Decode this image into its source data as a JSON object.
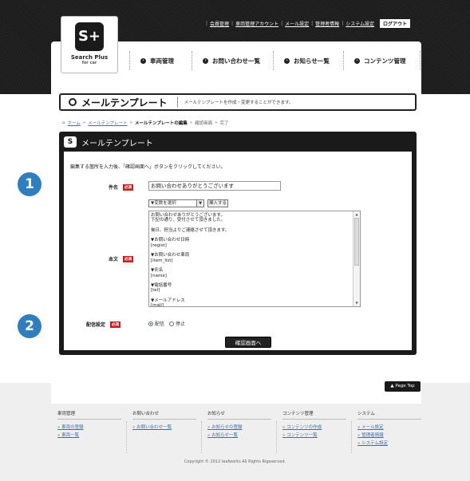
{
  "logo": {
    "mark": "S+",
    "title": "Search Plus",
    "sub": "for car"
  },
  "toplinks": [
    "会員管理",
    "車両管理アカウント",
    "メール設定",
    "管理者情報",
    "システム設定"
  ],
  "logout_label": "ログアウト",
  "nav": [
    "車両管理",
    "お問い合わせ一覧",
    "お知らせ一覧",
    "コンテンツ管理"
  ],
  "page": {
    "title": "メールテンプレート",
    "desc": "メールテンプレートを作成・変更することができます。"
  },
  "breadcrumb": {
    "home": "ホーム",
    "template": "メールテンプレート",
    "current": "メールテンプレートの編集",
    "confirm": "確認画面",
    "done": "完了",
    "sep": "»"
  },
  "panel": {
    "title": "メールテンプレート",
    "instruction": "編集する箇所を入力後、「確認画面へ」ボタンをクリックしてください。",
    "required_label": "必須",
    "subject_label": "件名",
    "subject_value": "お問い合わせありがとうございます",
    "var_select": "▼変数を選択",
    "insert_button": "挿入する",
    "body_label": "本文",
    "body_lines": [
      "お問い合わせありがとうございます。",
      "下記の通り、受付させて頂きました。",
      "",
      "後日、担当よりご連絡させて頂きます。",
      "",
      "▼お問い合わせ日時",
      "[regist]",
      "",
      "▼お問い合わせ車両",
      "[item_list]",
      "",
      "▼氏名",
      "[name]",
      "",
      "▼電話番号",
      "[tel]",
      "",
      "▼メールアドレス",
      "[mail]"
    ],
    "delivery_label": "配信設定",
    "radio_on": "配信",
    "radio_off": "停止",
    "confirm_button": "確認画面へ"
  },
  "pagetop_label": "Page Top",
  "badges": [
    "1",
    "2"
  ],
  "footer": {
    "cols": [
      {
        "head": "車両管理",
        "links": [
          "車両の登録",
          "車両一覧"
        ]
      },
      {
        "head": "お問い合わせ",
        "links": [
          "お問い合わせ一覧"
        ]
      },
      {
        "head": "お知らせ",
        "links": [
          "お知らせの登録",
          "お知らせ一覧"
        ]
      },
      {
        "head": "コンテンツ管理",
        "links": [
          "コンテンツの作成",
          "コンテンツ一覧"
        ]
      },
      {
        "head": "システム",
        "links": [
          "メール設定",
          "管理者情報",
          "システム設定"
        ]
      }
    ],
    "copyright": "Copyright © 2012 leafworks All Rights Rigeserved."
  }
}
